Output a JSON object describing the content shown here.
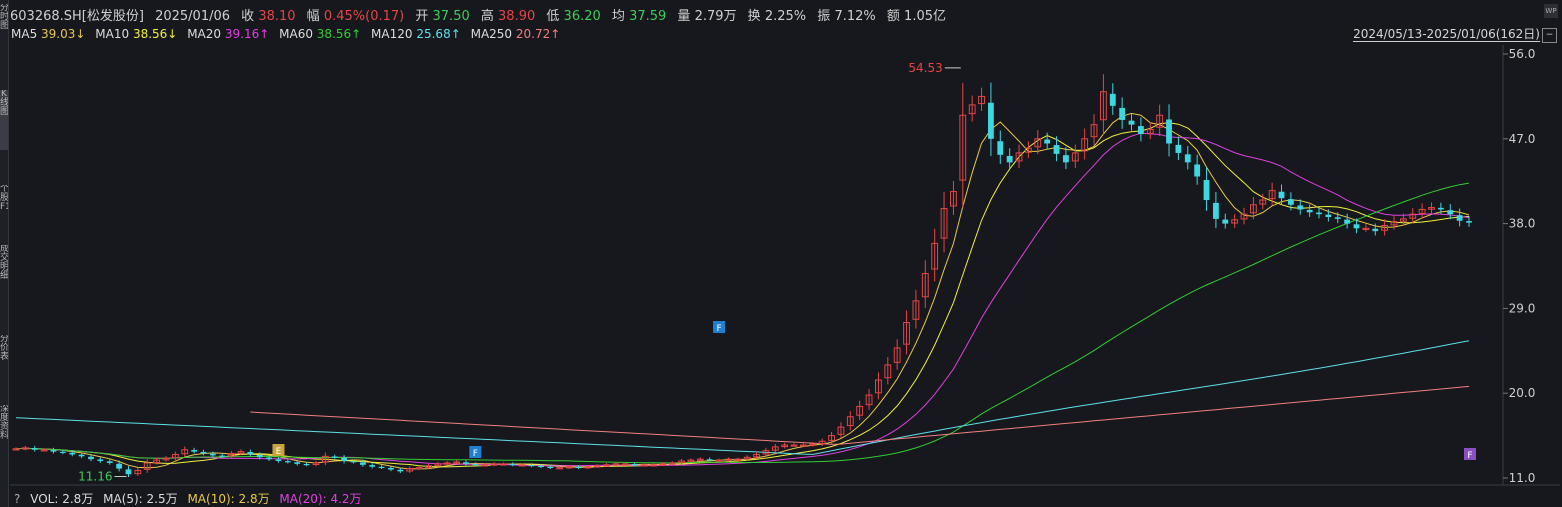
{
  "sidebar": {
    "tabs": [
      "分时图",
      "K线图",
      "个股F10",
      "成交明细",
      "分价表",
      "深度资料"
    ]
  },
  "header": {
    "code": "603268.SH[松发股份]",
    "date": "2025/01/06",
    "close_label": "收",
    "close": "38.10",
    "change_label": "幅",
    "change": "0.45%(0.17)",
    "open_label": "开",
    "open": "37.50",
    "high_label": "高",
    "high": "38.90",
    "low_label": "低",
    "low": "36.20",
    "avg_label": "均",
    "avg": "37.59",
    "vol_label": "量",
    "vol": "2.79万",
    "turnover_label": "换",
    "turnover": "2.25%",
    "amp_label": "振",
    "amp": "7.12%",
    "amount_label": "额",
    "amount": "1.05亿"
  },
  "ma_legend": [
    {
      "label": "MA5",
      "value": "39.03↓",
      "color": "#e8c84a"
    },
    {
      "label": "MA10",
      "value": "38.56↓",
      "color": "#f0f040"
    },
    {
      "label": "MA20",
      "value": "39.16↑",
      "color": "#e040e0"
    },
    {
      "label": "MA60",
      "value": "38.56↑",
      "color": "#33cc33"
    },
    {
      "label": "MA120",
      "value": "25.68↑",
      "color": "#5ee0e8"
    },
    {
      "label": "MA250",
      "value": "20.72↑",
      "color": "#f08080"
    }
  ],
  "range_label": "2024/05/13-2025/01/06(162日)",
  "toggle_label": "−",
  "logo_text": "WP",
  "volume_legend": {
    "help": "?",
    "vol": "VOL: 2.8万",
    "ma5": "MA(5): 2.5万",
    "ma10": "MA(10): 2.8万",
    "ma20": "MA(20): 4.2万"
  },
  "colors": {
    "up": "#e64545",
    "down": "#3ed6e0",
    "background": "#16181d",
    "grid": "#2c2f36"
  },
  "chart_data": {
    "type": "candlestick",
    "y_ticks": [
      "56.0",
      "47.0",
      "38.0",
      "29.0",
      "20.0",
      "11.0"
    ],
    "ylim": [
      11.0,
      56.0
    ],
    "annotations": {
      "high": "54.53",
      "low": "11.16"
    },
    "markers": [
      "E",
      "F",
      "F",
      "F"
    ],
    "closes": [
      14.1,
      14.2,
      14.0,
      14.0,
      13.8,
      13.7,
      13.5,
      13.3,
      13.0,
      12.8,
      12.6,
      12.0,
      11.4,
      11.8,
      12.6,
      12.9,
      13.1,
      13.5,
      14.0,
      13.8,
      13.6,
      13.4,
      13.3,
      13.6,
      13.8,
      13.5,
      13.2,
      13.0,
      12.8,
      12.7,
      12.5,
      12.4,
      12.6,
      13.3,
      13.2,
      12.8,
      12.7,
      12.4,
      12.2,
      12.1,
      11.9,
      11.7,
      12.0,
      12.1,
      12.3,
      12.5,
      12.6,
      12.7,
      12.5,
      12.4,
      12.4,
      12.5,
      12.5,
      12.4,
      12.4,
      12.3,
      12.2,
      12.1,
      12.1,
      12.2,
      12.1,
      12.2,
      12.3,
      12.4,
      12.5,
      12.5,
      12.4,
      12.4,
      12.4,
      12.5,
      12.6,
      12.8,
      12.9,
      13.0,
      12.9,
      12.9,
      13.0,
      13.0,
      13.2,
      13.5,
      13.9,
      14.3,
      14.5,
      14.5,
      14.5,
      14.6,
      14.9,
      15.5,
      16.4,
      17.5,
      18.6,
      19.8,
      21.4,
      23.0,
      24.8,
      27.5,
      29.8,
      32.7,
      35.9,
      39.6,
      41.4,
      49.5,
      50.6,
      51.5,
      47.0,
      45.3,
      44.5,
      45.5,
      46.0,
      47.0,
      46.5,
      45.4,
      44.5,
      45.5,
      47.0,
      48.5,
      52.0,
      50.5,
      49.0,
      48.5,
      47.5,
      48.0,
      49.5,
      46.5,
      45.5,
      44.5,
      43.0,
      40.5,
      38.5,
      38.0,
      38.4,
      39.0,
      40.0,
      40.5,
      41.5,
      40.7,
      40.0,
      39.5,
      39.2,
      39.0,
      38.7,
      38.5,
      38.0,
      37.5,
      37.5,
      37.2,
      37.8,
      38.2,
      38.5,
      39.0,
      39.5,
      39.7,
      39.5,
      39.0,
      38.3,
      38.1
    ],
    "ma250_endpoints": [
      [
        0,
        18.0
      ],
      [
        161,
        20.72
      ]
    ]
  }
}
